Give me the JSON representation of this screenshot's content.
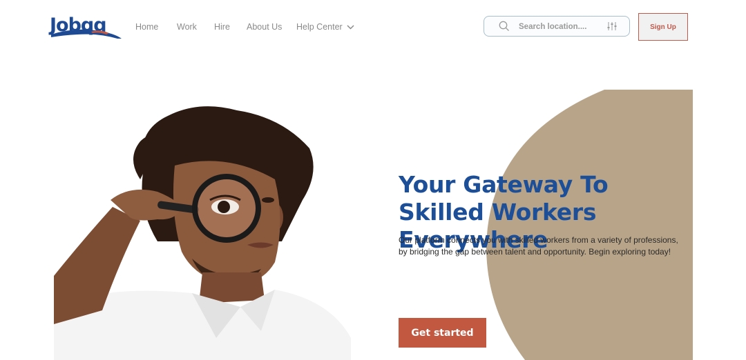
{
  "brand": {
    "name": "Jobqq",
    "colors": {
      "primary": "#1e4a93",
      "accent": "#c35841",
      "tan": "#b8a488"
    }
  },
  "nav": {
    "items": [
      {
        "label": "Home"
      },
      {
        "label": "Work"
      },
      {
        "label": "Hire"
      },
      {
        "label": "About Us"
      },
      {
        "label": "Help Center",
        "icon": "chevron-down-icon"
      }
    ]
  },
  "search": {
    "placeholder": "Search location....",
    "icon": "search-icon",
    "filter_icon": "sliders-icon"
  },
  "header": {
    "signup_label": "Sign Up"
  },
  "hero": {
    "title": "Your Gateway To Skilled Workers Everywhere",
    "description": "Our platform connects you with skilled workers from a variety of professions, by bridging the gap between talent and opportunity. Begin exploring today!",
    "cta_label": "Get started",
    "image": "man-with-magnifying-glass"
  }
}
